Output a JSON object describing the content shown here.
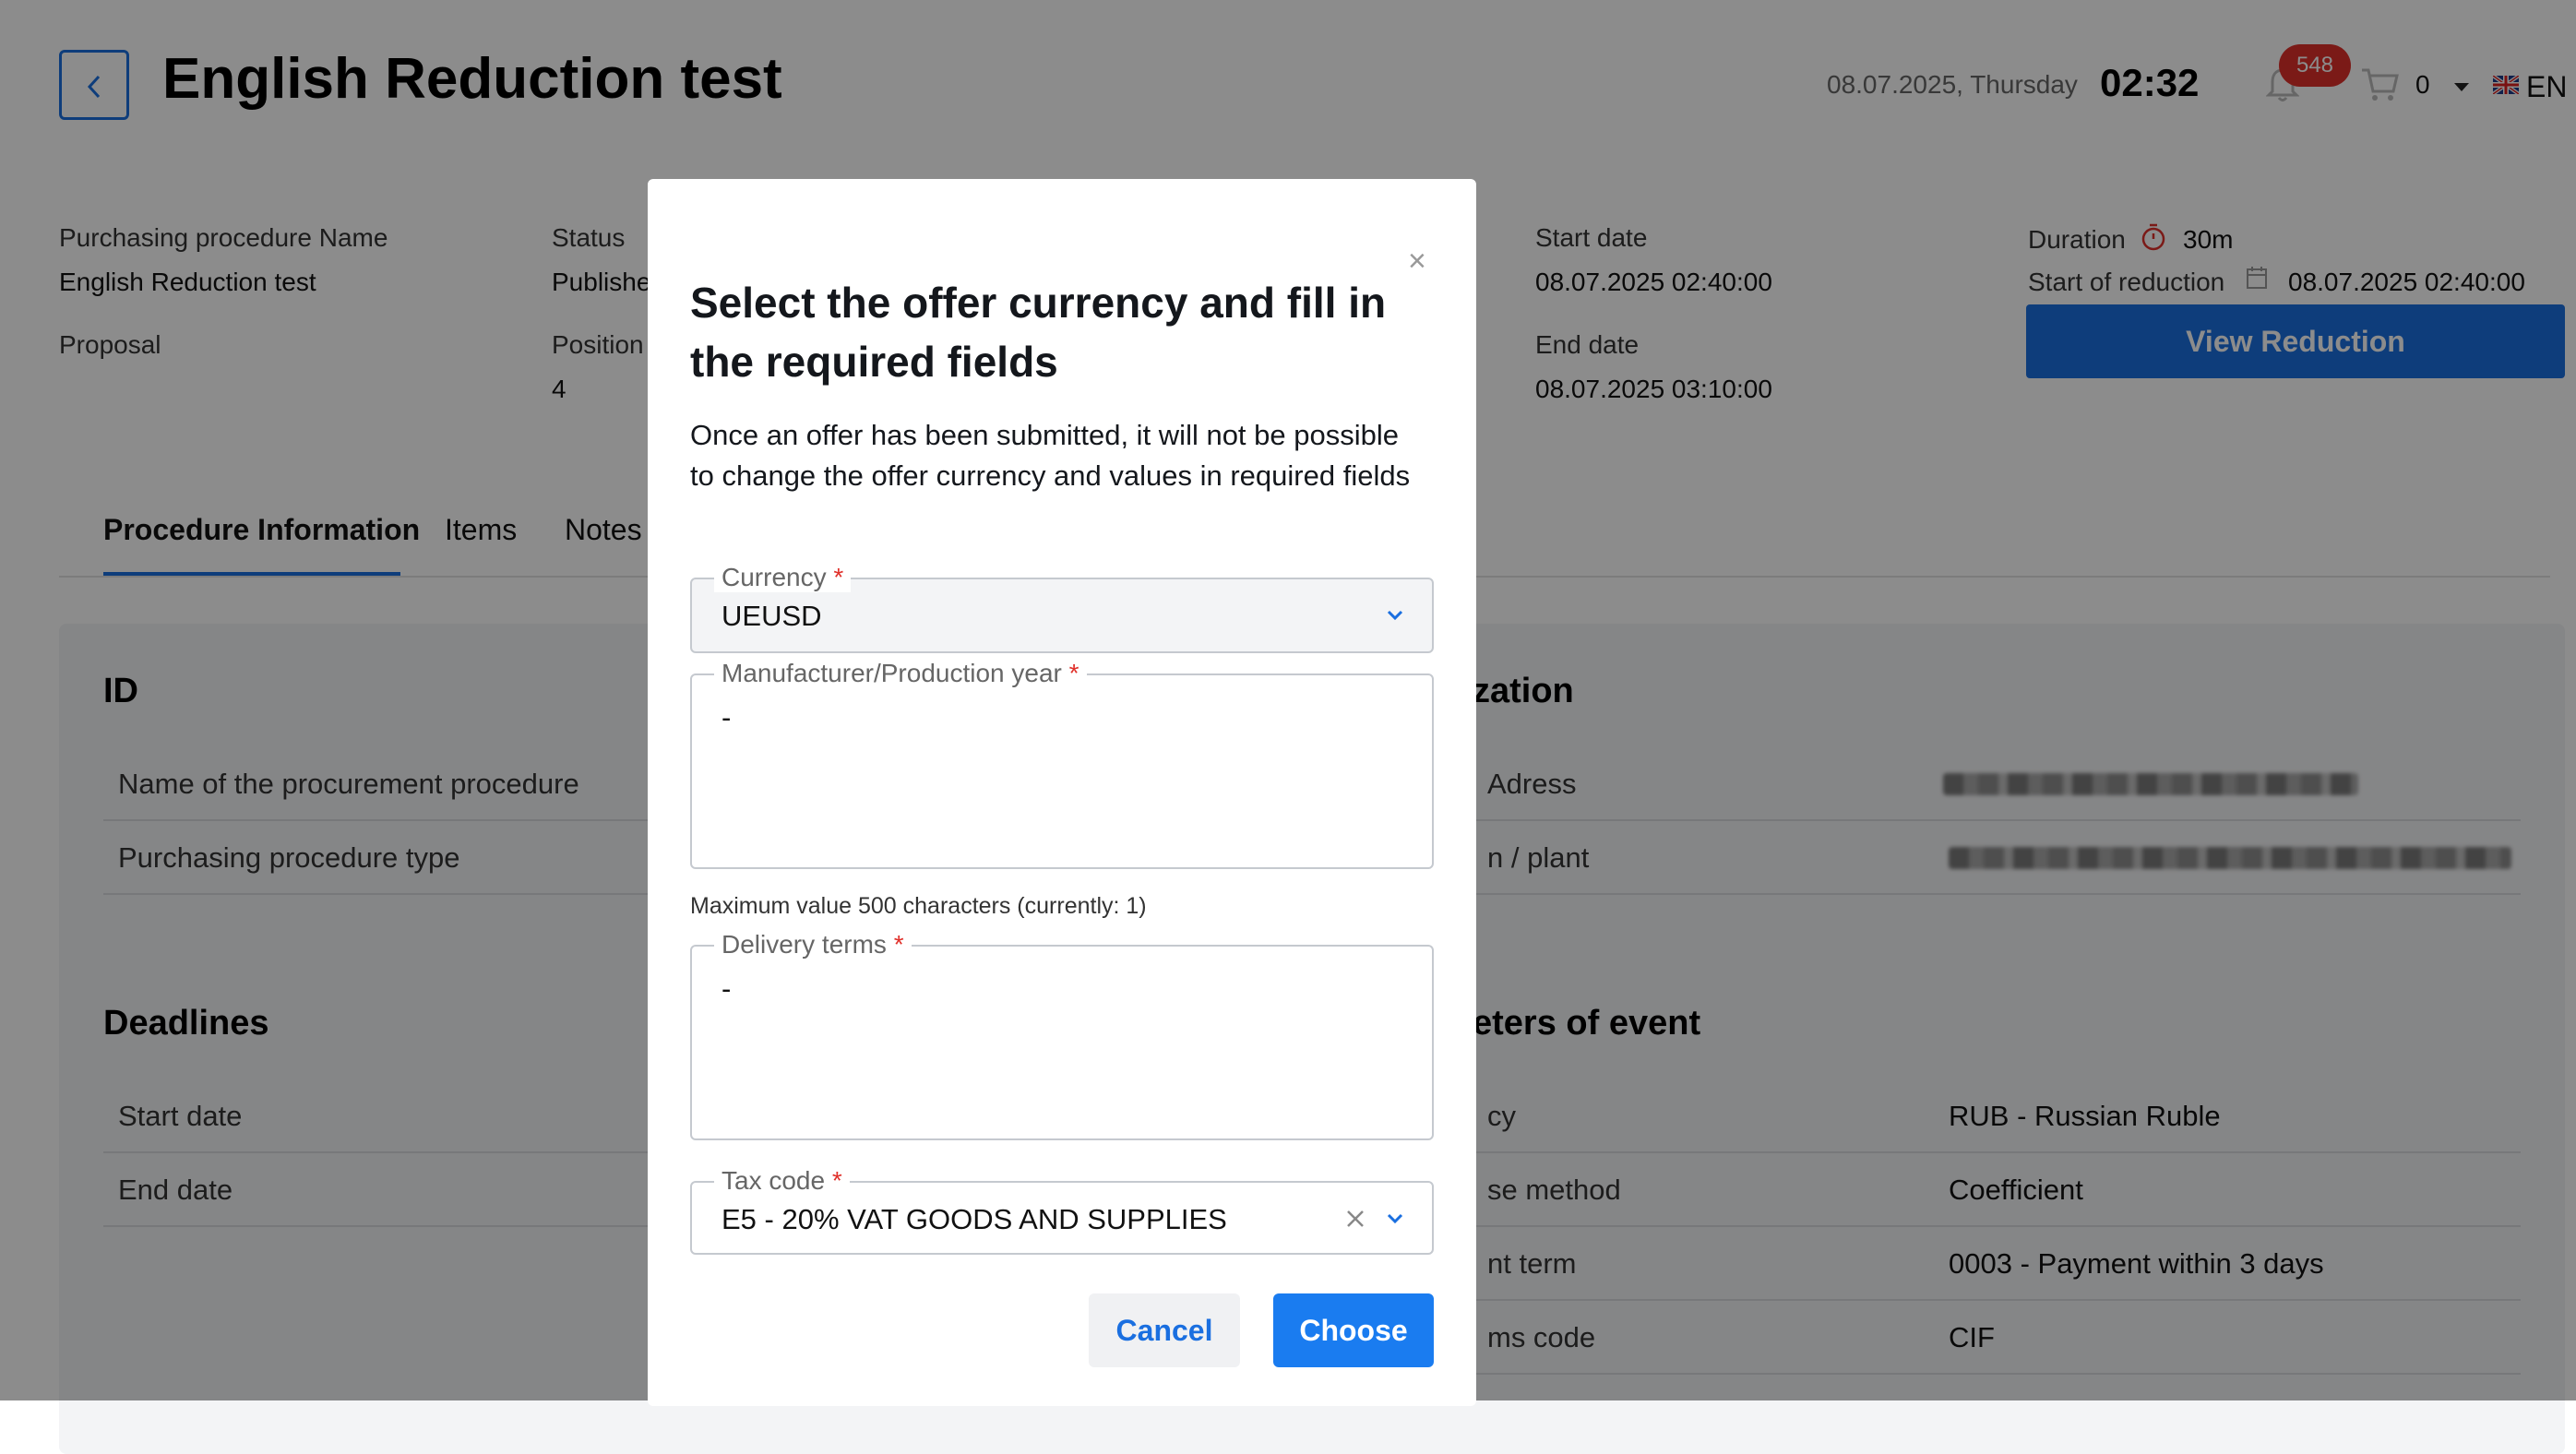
{
  "header": {
    "title": "English Reduction test",
    "date": "08.07.2025, Thursday",
    "time": "02:32",
    "notifications_count": "548",
    "cart_count": "0",
    "language": "EN"
  },
  "info": {
    "procedure_name_label": "Purchasing procedure Name",
    "procedure_name_value": "English Reduction test",
    "proposal_label": "Proposal",
    "status_label": "Status",
    "status_value": "Publishe",
    "position_label": "Position",
    "position_value": "4",
    "start_date_label": "Start date",
    "start_date_value": "08.07.2025 02:40:00",
    "end_date_label": "End date",
    "end_date_value": "08.07.2025 03:10:00",
    "duration_label": "Duration",
    "duration_value": "30m",
    "start_reduction_label": "Start of reduction",
    "start_reduction_value": "08.07.2025 02:40:00",
    "view_button": "View Reduction"
  },
  "tabs": [
    "Procedure Information",
    "Items",
    "Notes"
  ],
  "sections": {
    "id_title": "ID",
    "id_rows": [
      "Name of the procurement procedure",
      "Purchasing procedure type"
    ],
    "deadlines_title": "Deadlines",
    "deadline_rows": [
      "Start date",
      "End date"
    ],
    "org_title_partial": "zation",
    "org_rows": [
      "Adress",
      "n / plant"
    ],
    "params_title_partial": "eters of event",
    "params_rows": [
      {
        "label": "cy",
        "value": "RUB - Russian Ruble"
      },
      {
        "label": "se method",
        "value": "Coefficient"
      },
      {
        "label": "nt term",
        "value": "0003 - Payment within 3 days"
      },
      {
        "label": "ms code",
        "value": "CIF"
      }
    ]
  },
  "modal": {
    "close": "×",
    "title": "Select the offer currency and fill in the required fields",
    "text": "Once an offer has been submitted, it will not be possible to change the offer currency and values in required fields",
    "currency_label": "Currency",
    "currency_value": "UEUSD",
    "manufacturer_label": "Manufacturer/Production year",
    "manufacturer_value": "-",
    "hint": "Maximum value 500 characters (currently: 1)",
    "delivery_label": "Delivery terms",
    "delivery_value": "-",
    "tax_label": "Tax code",
    "tax_value": "E5 - 20% VAT GOODS AND SUPPLIES",
    "required_mark": "*",
    "cancel": "Cancel",
    "choose": "Choose"
  },
  "colors": {
    "accent": "#1a6fe0",
    "badge": "#e0302a",
    "overlay": "rgba(0,0,0,0.45)"
  }
}
